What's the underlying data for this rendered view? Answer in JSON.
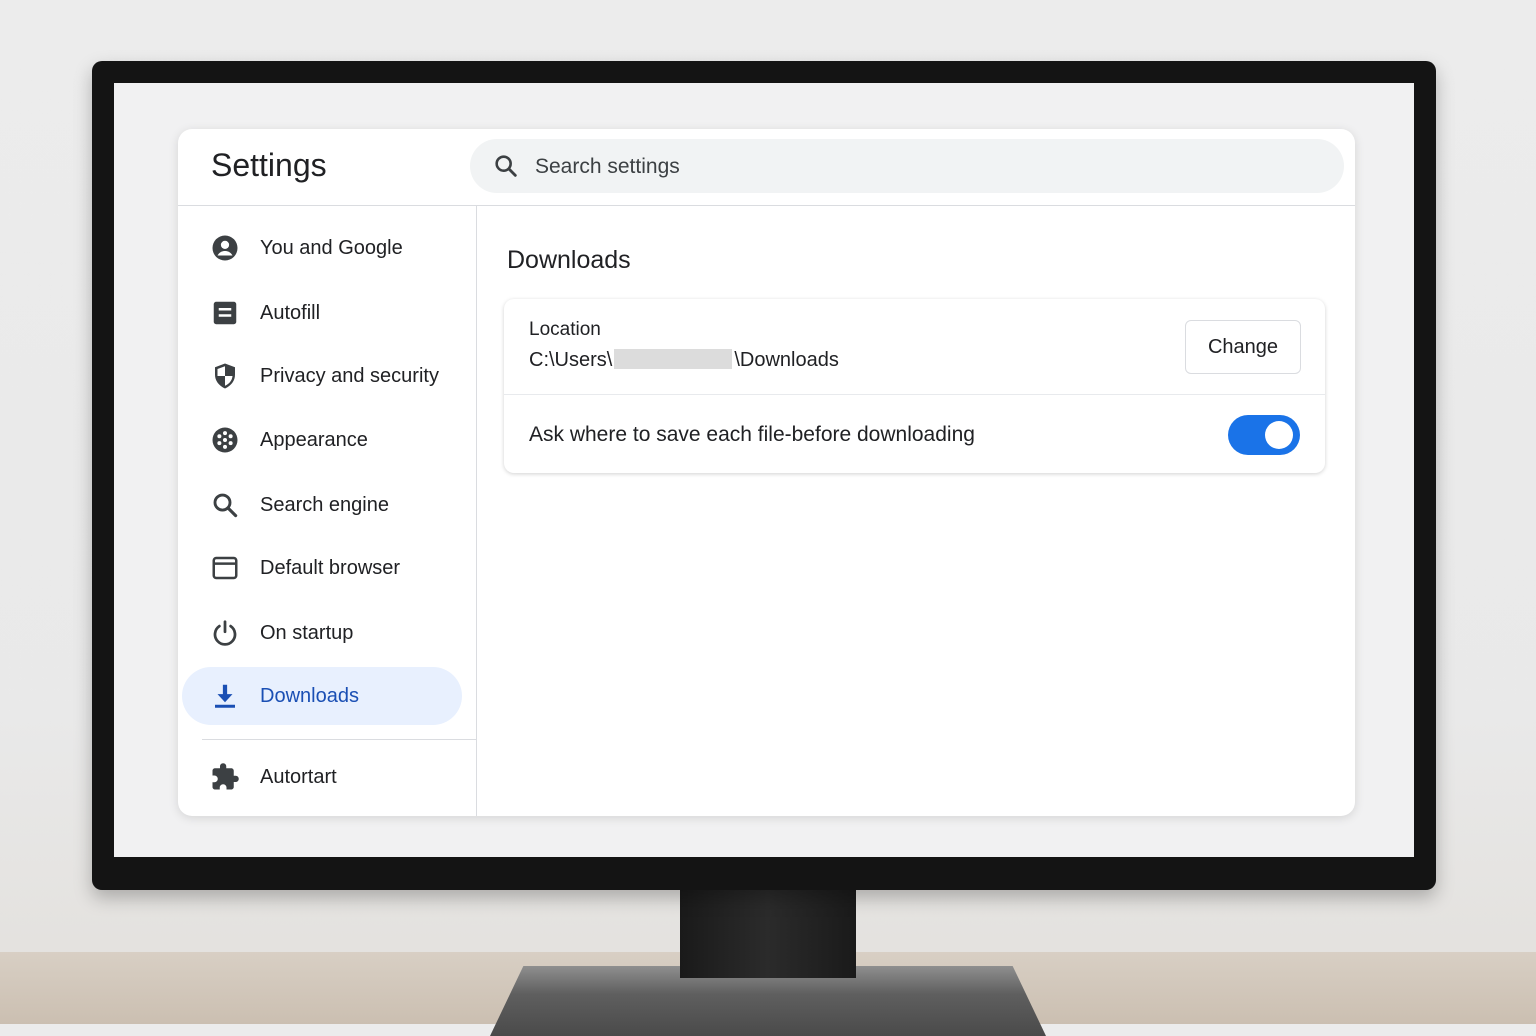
{
  "header": {
    "title": "Settings",
    "search_placeholder": "Search settings"
  },
  "sidebar": {
    "items": [
      {
        "label": "You and Google",
        "icon": "account-circle-icon"
      },
      {
        "label": "Autofill",
        "icon": "autofill-icon"
      },
      {
        "label": "Privacy and security",
        "icon": "shield-icon"
      },
      {
        "label": "Appearance",
        "icon": "palette-icon"
      },
      {
        "label": "Search engine",
        "icon": "search-icon"
      },
      {
        "label": "Default browser",
        "icon": "browser-window-icon"
      },
      {
        "label": "On startup",
        "icon": "power-icon"
      },
      {
        "label": "Downloads",
        "icon": "download-icon",
        "active": true
      },
      {
        "label": "Autortart",
        "icon": "puzzle-icon"
      }
    ]
  },
  "main": {
    "section_title": "Downloads",
    "location": {
      "label": "Location",
      "path_prefix": "C:\\Users\\",
      "path_suffix": "\\Downloads",
      "change_label": "Change"
    },
    "ask_setting": {
      "label": "Ask where to save each file-before downloading",
      "enabled": true
    }
  },
  "colors": {
    "accent": "#1a73e8",
    "active_nav_bg": "#e8f0fe",
    "active_nav_text": "#1a4fb4"
  }
}
